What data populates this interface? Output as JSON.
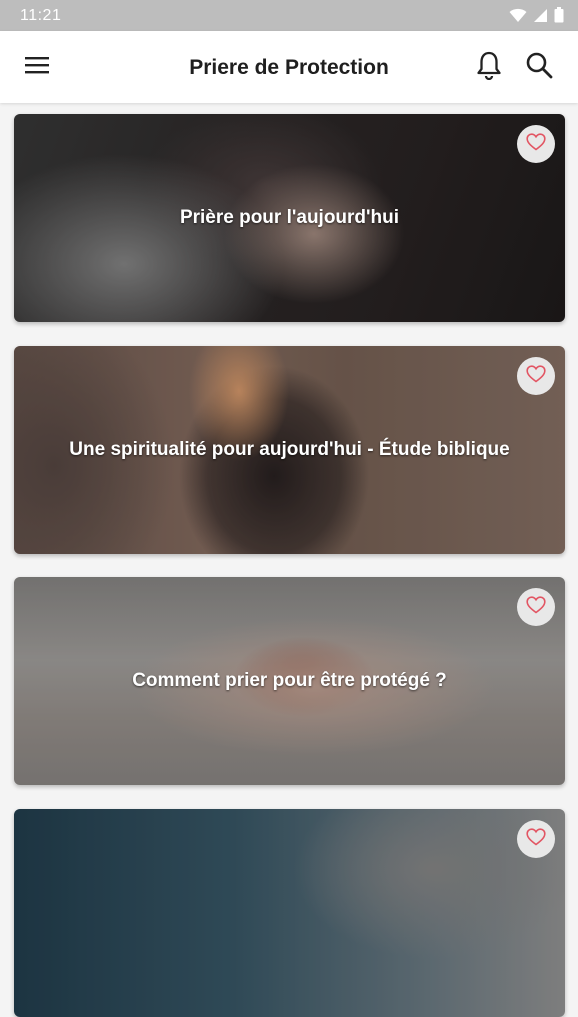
{
  "status_bar": {
    "time": "11:21",
    "icons": [
      "wifi-icon",
      "signal-icon",
      "battery-icon"
    ]
  },
  "app_bar": {
    "title": "Priere de Protection",
    "icons": [
      "menu-icon",
      "bell-icon",
      "search-icon"
    ]
  },
  "cards": [
    {
      "title": "Prière pour l'aujourd'hui",
      "favorite_icon": "heart-outline-icon"
    },
    {
      "title": "Une spiritualité pour aujourd'hui - Étude biblique",
      "favorite_icon": "heart-outline-icon"
    },
    {
      "title": "Comment prier pour être protégé ?",
      "favorite_icon": "heart-outline-icon"
    },
    {
      "title": "",
      "favorite_icon": "heart-outline-icon"
    }
  ],
  "colors": {
    "status_bar_bg": "#bdbdbd",
    "app_bar_bg": "#ffffff",
    "page_bg": "#f4f4f4",
    "heart_accent": "#e25563"
  }
}
